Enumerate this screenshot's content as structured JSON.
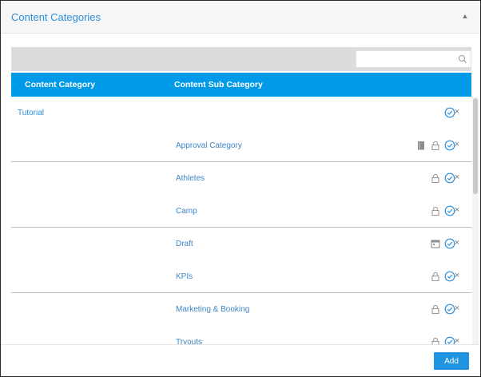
{
  "panel": {
    "title": "Content Categories",
    "collapse_icon": "chevron-up-icon"
  },
  "search": {
    "value": "",
    "placeholder": ""
  },
  "table": {
    "columns": [
      "Content Category",
      "Content Sub Category"
    ],
    "rows": [
      {
        "category": "Tutorial",
        "sub": "",
        "icons": [
          "check-circle-icon"
        ]
      },
      {
        "category": "",
        "sub": "Approval Category",
        "icons": [
          "book-icon",
          "lock-icon",
          "check-circle-icon"
        ]
      },
      {
        "category": "",
        "sub": "Athletes",
        "icons": [
          "lock-icon",
          "check-circle-icon"
        ]
      },
      {
        "category": "",
        "sub": "Camp",
        "icons": [
          "lock-icon",
          "check-circle-icon"
        ]
      },
      {
        "category": "",
        "sub": "Draft",
        "icons": [
          "calendar-icon",
          "check-circle-icon"
        ]
      },
      {
        "category": "",
        "sub": "KPIs",
        "icons": [
          "lock-icon",
          "check-circle-icon"
        ]
      },
      {
        "category": "",
        "sub": "Marketing & Booking",
        "icons": [
          "lock-icon",
          "check-circle-icon"
        ]
      },
      {
        "category": "",
        "sub": "Tryouts",
        "icons": [
          "lock-icon",
          "check-circle-icon"
        ]
      }
    ],
    "delete_symbol": "×"
  },
  "footer": {
    "add_label": "Add"
  },
  "colors": {
    "header_bar": "#009ae8",
    "link_text": "#2c8fdc",
    "add_button": "#1e94e0"
  }
}
